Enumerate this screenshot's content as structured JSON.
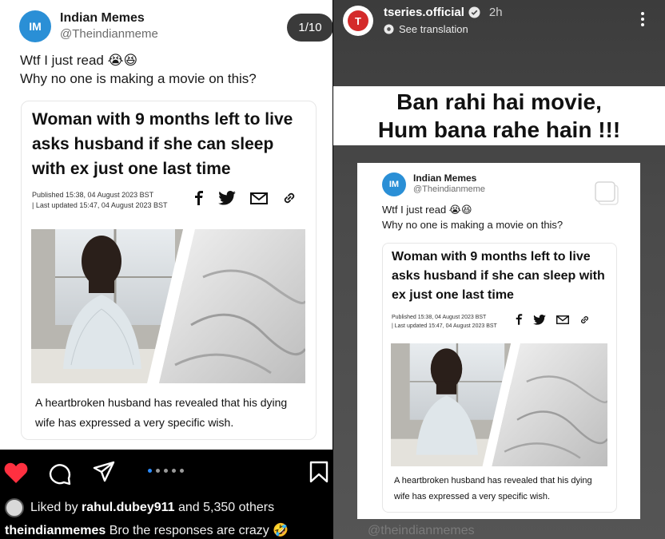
{
  "left_post": {
    "tweet": {
      "avatar_text": "IM",
      "name": "Indian Memes",
      "handle": "@Theindianmeme",
      "text_line1": "Wtf I just read 😭😆",
      "text_line2": "Why no one is making a movie on this?",
      "carousel_counter": "1/10"
    },
    "article": {
      "headline": "Woman with 9 months left to live asks husband if she can sleep with ex just one last time",
      "published": "Published 15:38, 04 August 2023 BST",
      "updated": "| Last updated 15:47, 04 August 2023 BST",
      "share_icons": [
        "facebook-icon",
        "twitter-icon",
        "mail-icon",
        "link-icon"
      ],
      "caption": "A heartbroken husband has revealed that his dying wife has expressed a very specific wish."
    },
    "actions": {
      "liked": true,
      "carousel_dots": 5,
      "active_dot": 0
    },
    "likes": {
      "prefix": "Liked by ",
      "user": "rahul.dubey911",
      "suffix": " and 5,350 others"
    },
    "caption": {
      "user": "theindianmemes",
      "text": " Bro the responses are crazy 🤣"
    }
  },
  "right_story": {
    "username": "tseries.official",
    "time": "2h",
    "avatar_text": "T",
    "see_translation": "See translation",
    "text_line1": "Ban rahi hai movie,",
    "text_line2": "Hum bana rahe hain !!!",
    "tweet": {
      "avatar_text": "IM",
      "name": "Indian Memes",
      "handle": "@Theindianmeme",
      "text_line1": "Wtf I just read 😭😆",
      "text_line2": "Why no one is making a movie on this?"
    },
    "article": {
      "headline": "Woman with 9 months left to live asks husband if she can sleep with ex just one last time",
      "published": "Published 15:38, 04 August 2023 BST",
      "updated": "| Last updated 15:47, 04 August 2023 BST",
      "caption": "A heartbroken husband has revealed that his dying wife has expressed a very specific wish."
    },
    "mention": "@theindianmemes"
  },
  "colors": {
    "like_red": "#ff3040",
    "dot_blue": "#2b8cff",
    "avatar_blue": "#2a8fd6",
    "tseries_red": "#d42a2a"
  }
}
